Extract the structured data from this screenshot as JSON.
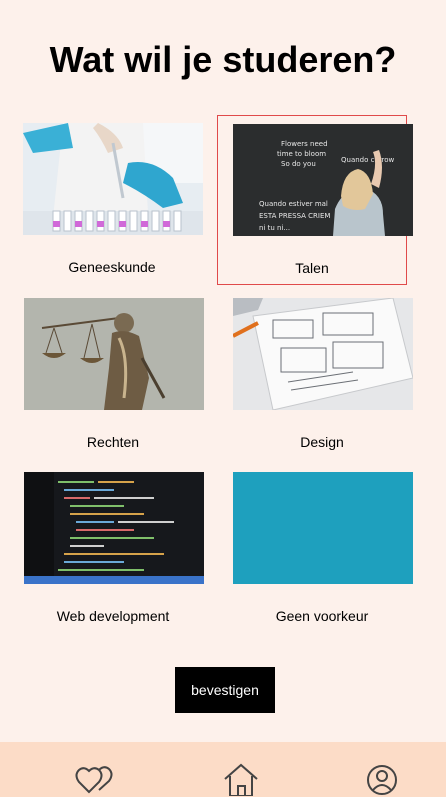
{
  "page": {
    "title": "Wat wil je studeren?"
  },
  "options": [
    {
      "label": "Geneeskunde",
      "image": "lab-pipette-photo",
      "selected": false
    },
    {
      "label": "Talen",
      "image": "chalkboard-writing-photo",
      "selected": true
    },
    {
      "label": "Rechten",
      "image": "lady-justice-statue-photo",
      "selected": false
    },
    {
      "label": "Design",
      "image": "wireframe-sketches-photo",
      "selected": false
    },
    {
      "label": "Web development",
      "image": "code-on-screen-photo",
      "selected": false
    },
    {
      "label": "Geen voorkeur",
      "image": "turquoise-water-photo",
      "selected": false
    }
  ],
  "chalkboard_text": [
    "Flowers need",
    "time to bloom",
    "So do you",
    "Quando carrow",
    "Quando estiver mal",
    "ESTA PRESSA CRIEM",
    "ni tu ni..."
  ],
  "confirm_button": {
    "label": "bevestigen"
  },
  "bottom_nav": {
    "items": [
      {
        "icon": "hearts-icon"
      },
      {
        "icon": "home-icon"
      },
      {
        "icon": "profile-icon"
      }
    ]
  },
  "colors": {
    "background": "#fdf1eb",
    "navbar": "#fcdcc7",
    "selected_border": "#e04a4a",
    "button": "#000000"
  }
}
